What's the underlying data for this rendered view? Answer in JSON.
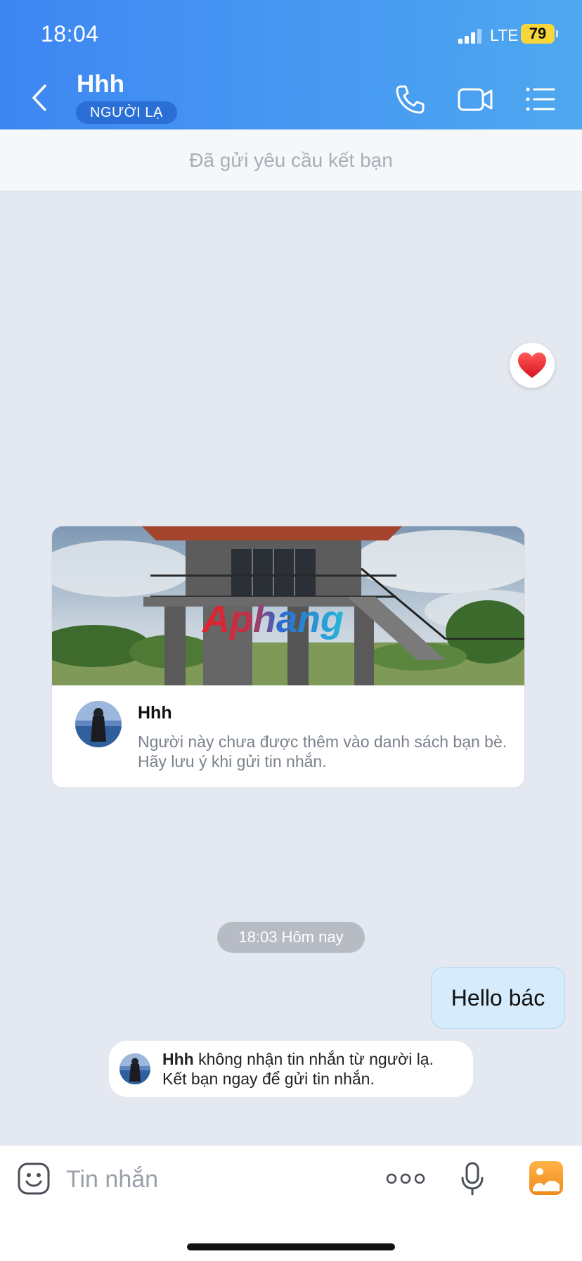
{
  "status_bar": {
    "time": "18:04",
    "network": "LTE",
    "battery": "79"
  },
  "header": {
    "title": "Hhh",
    "badge": "NGƯỜI LẠ",
    "icons": [
      "chevron-left-icon",
      "phone-icon",
      "video-call-icon",
      "menu-list-icon"
    ]
  },
  "friend_request_bar": {
    "text": "Đã gửi yêu cầu kết bạn"
  },
  "reaction": {
    "emoji": "❤️"
  },
  "profile_card": {
    "photo_watermark": "Aphang",
    "name": "Hhh",
    "description": "Người này chưa được thêm vào danh sách bạn bè. Hãy lưu ý khi gửi tin nhắn."
  },
  "conversation": {
    "timestamp": "18:03 Hôm nay",
    "outgoing_message": "Hello bác",
    "notice": {
      "name": "Hhh",
      "line1_rest": " không nhận tin nhắn từ người lạ.",
      "line2": "Kết bạn ngay để gửi tin nhắn."
    }
  },
  "composer": {
    "placeholder": "Tin nhắn",
    "icons": [
      "emoji-icon",
      "more-icon",
      "microphone-icon",
      "image-icon"
    ]
  },
  "colors": {
    "header_start": "#3e86f3",
    "header_end": "#4ea8f0",
    "badge": "#2a6fd6",
    "outgoing_bubble": "#d6ecfc",
    "chat_background": "#e4e8f0",
    "battery": "#f7d63c"
  }
}
